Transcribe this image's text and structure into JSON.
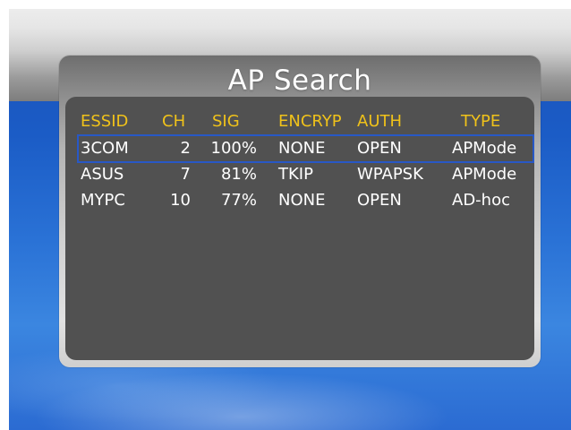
{
  "dialog": {
    "title": "AP Search"
  },
  "table": {
    "headers": {
      "essid": "ESSID",
      "ch": "CH",
      "sig": "SIG",
      "encryp": "ENCRYP",
      "auth": "AUTH",
      "type": "TYPE"
    },
    "rows": [
      {
        "essid": "3COM",
        "ch": "2",
        "sig": "100%",
        "encryp": "NONE",
        "auth": "OPEN",
        "type": "APMode",
        "selected": true
      },
      {
        "essid": "ASUS",
        "ch": "7",
        "sig": "81%",
        "encryp": "TKIP",
        "auth": "WPAPSK",
        "type": "APMode"
      },
      {
        "essid": "MYPC",
        "ch": "10",
        "sig": "77%",
        "encryp": "NONE",
        "auth": "OPEN",
        "type": "AD-hoc"
      }
    ]
  },
  "colors": {
    "header_text": "#f0c21a",
    "row_text": "#ffffff",
    "panel_bg": "#515151",
    "selection_border": "#2858c6"
  }
}
